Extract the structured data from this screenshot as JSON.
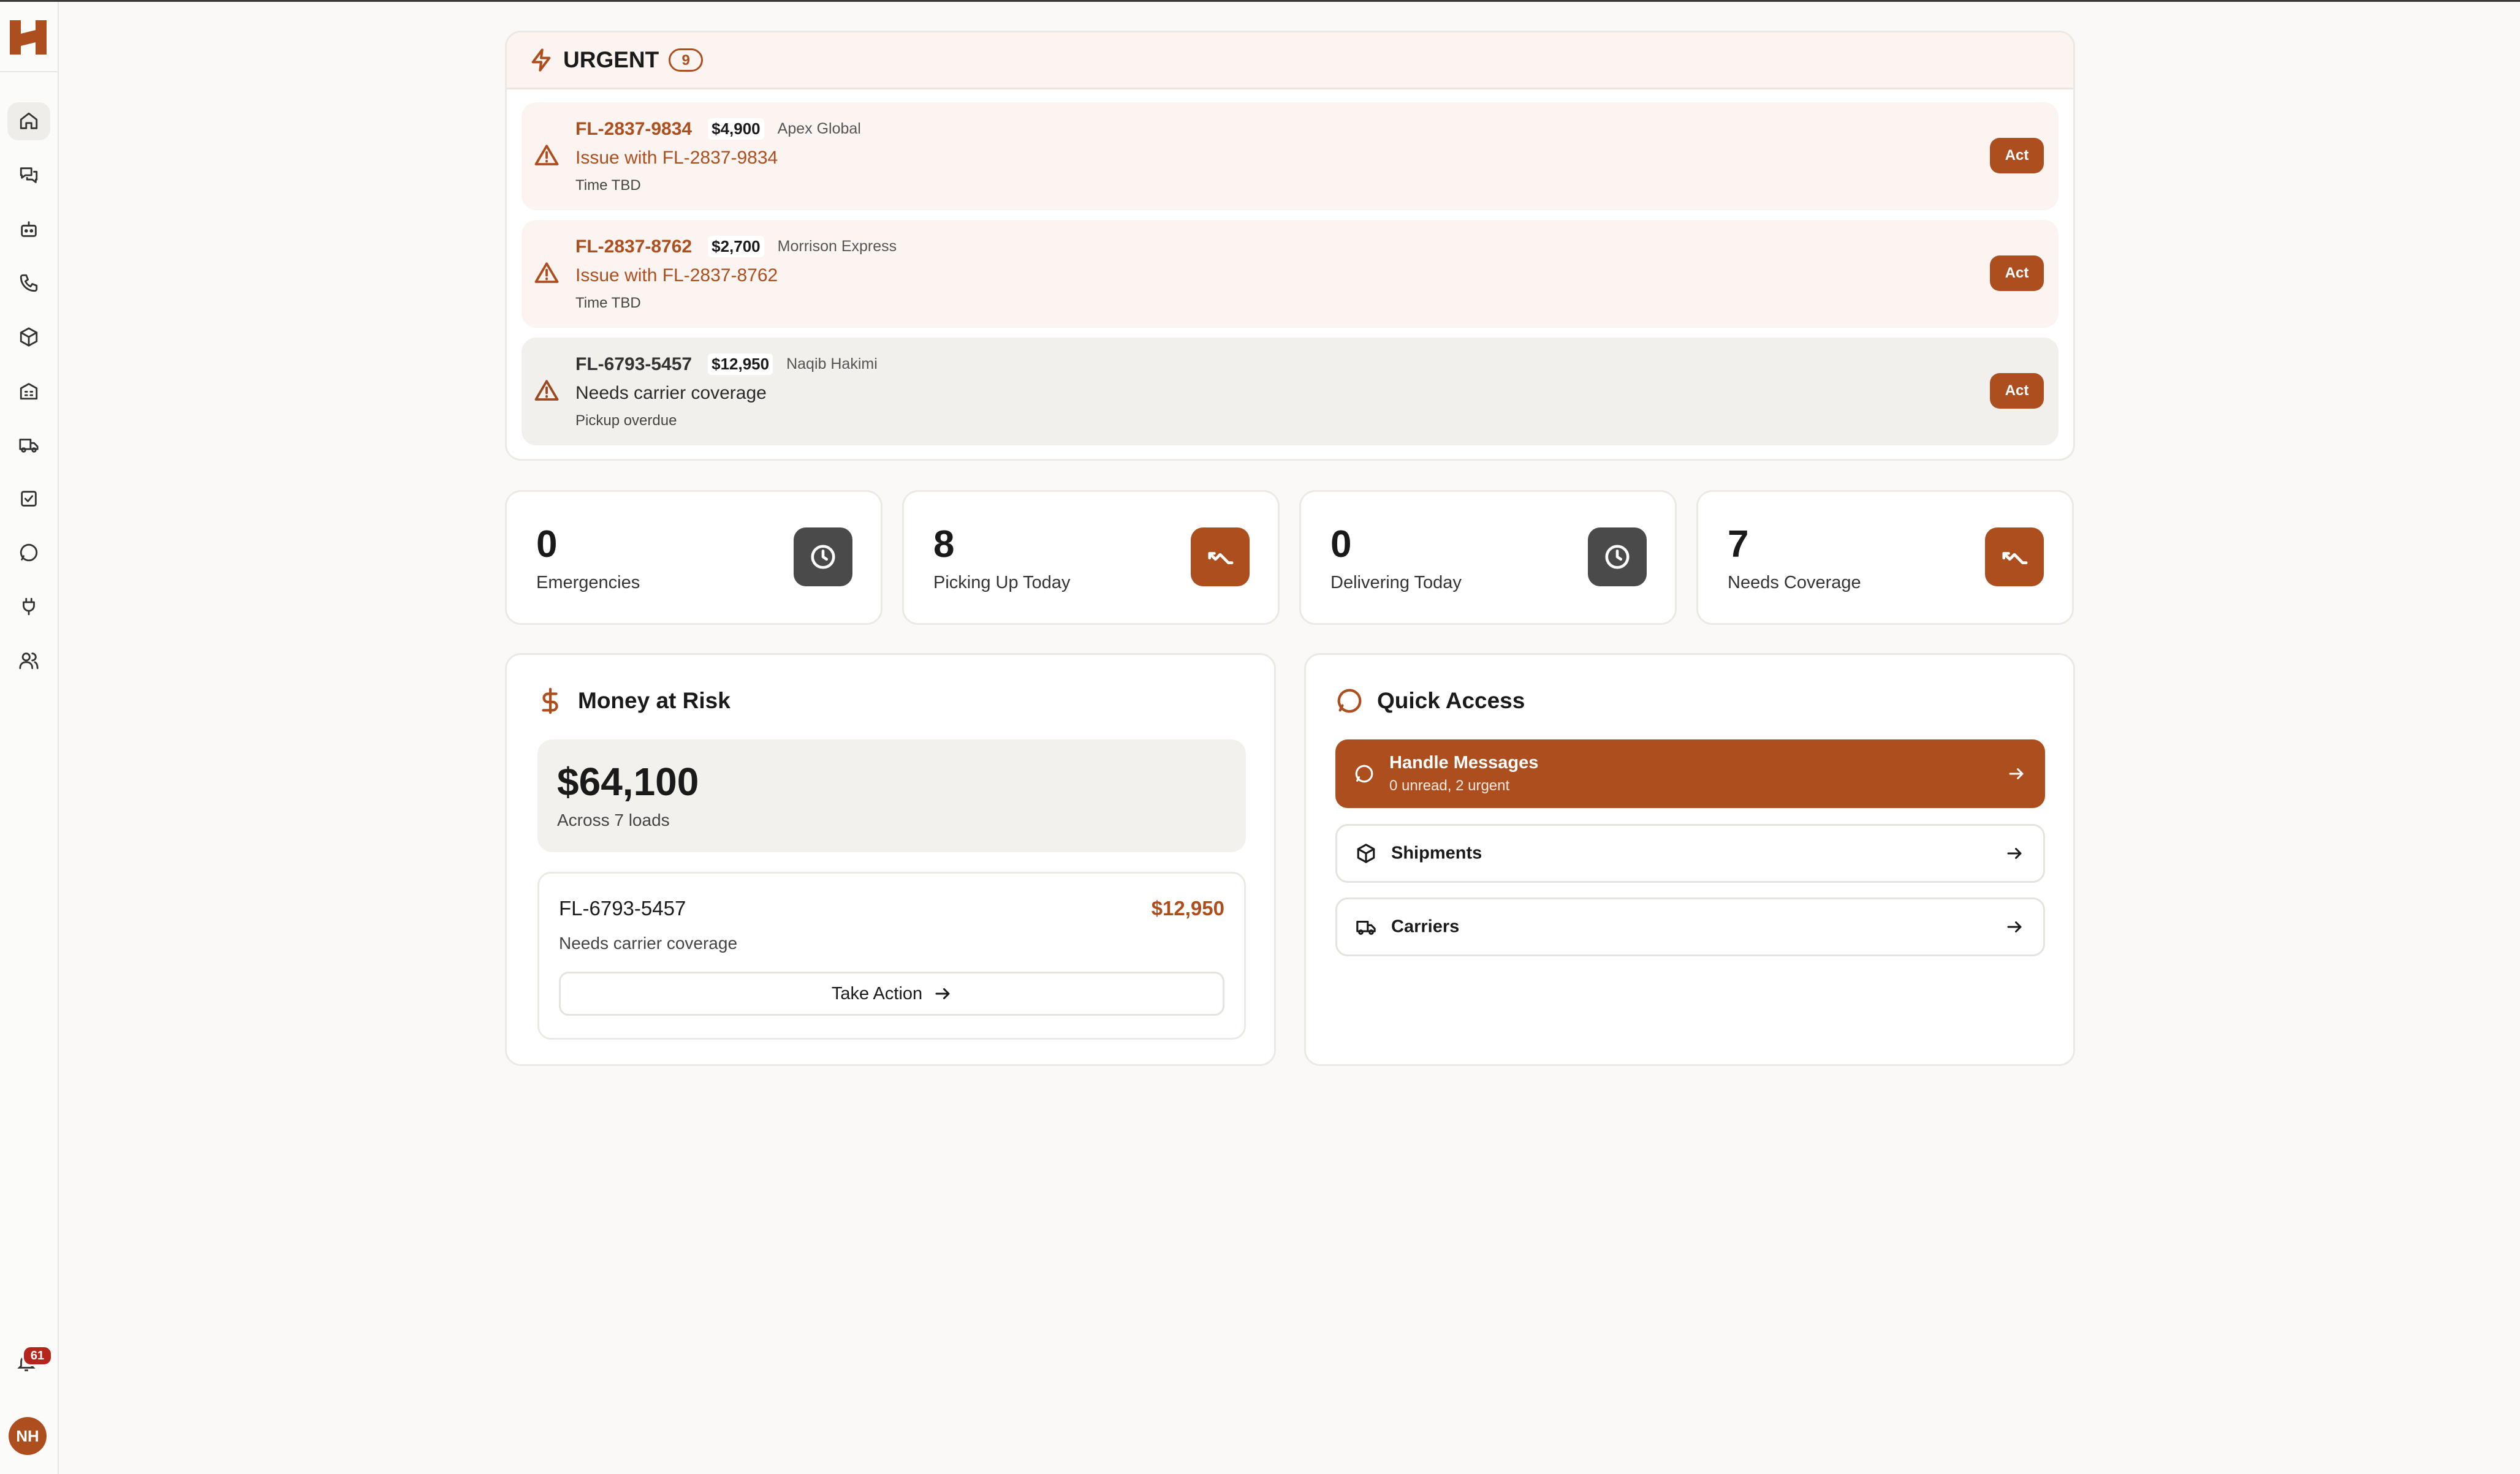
{
  "app": {
    "brand_color": "#ad4e1f",
    "avatar_initials": "NH",
    "notification_count": "61"
  },
  "sidebar": {
    "items": [
      {
        "icon": "home-icon",
        "active": true
      },
      {
        "icon": "messages-icon"
      },
      {
        "icon": "bot-icon"
      },
      {
        "icon": "phone-icon"
      },
      {
        "icon": "package-icon"
      },
      {
        "icon": "building-icon"
      },
      {
        "icon": "truck-icon"
      },
      {
        "icon": "checkbox-icon"
      },
      {
        "icon": "chat-icon"
      },
      {
        "icon": "plug-icon"
      },
      {
        "icon": "users-icon"
      }
    ]
  },
  "urgent": {
    "title": "URGENT",
    "count": "9",
    "items": [
      {
        "code": "FL-2837-9834",
        "amount": "$4,900",
        "company": "Apex Global",
        "issue": "Issue with FL-2837-9834",
        "sub": "Time TBD",
        "action": "Act"
      },
      {
        "code": "FL-2837-8762",
        "amount": "$2,700",
        "company": "Morrison Express",
        "issue": "Issue with FL-2837-8762",
        "sub": "Time TBD",
        "action": "Act"
      },
      {
        "code": "FL-6793-5457",
        "amount": "$12,950",
        "company": "Naqib Hakimi",
        "issue": "Needs carrier coverage",
        "sub": "Pickup overdue",
        "action": "Act"
      }
    ]
  },
  "stats": [
    {
      "value": "0",
      "label": "Emergencies",
      "icon": "clock-icon"
    },
    {
      "value": "8",
      "label": "Picking Up Today",
      "icon": "trend-icon"
    },
    {
      "value": "0",
      "label": "Delivering Today",
      "icon": "clock-icon"
    },
    {
      "value": "7",
      "label": "Needs Coverage",
      "icon": "trend-icon"
    }
  ],
  "money": {
    "title": "Money at Risk",
    "total": "$64,100",
    "total_sub": "Across 7 loads",
    "item": {
      "code": "FL-6793-5457",
      "amount": "$12,950",
      "desc": "Needs carrier coverage",
      "button": "Take Action"
    }
  },
  "quick": {
    "title": "Quick Access",
    "primary": {
      "label": "Handle Messages",
      "sub": "0 unread, 2 urgent"
    },
    "links": [
      {
        "label": "Shipments"
      },
      {
        "label": "Carriers"
      }
    ]
  }
}
